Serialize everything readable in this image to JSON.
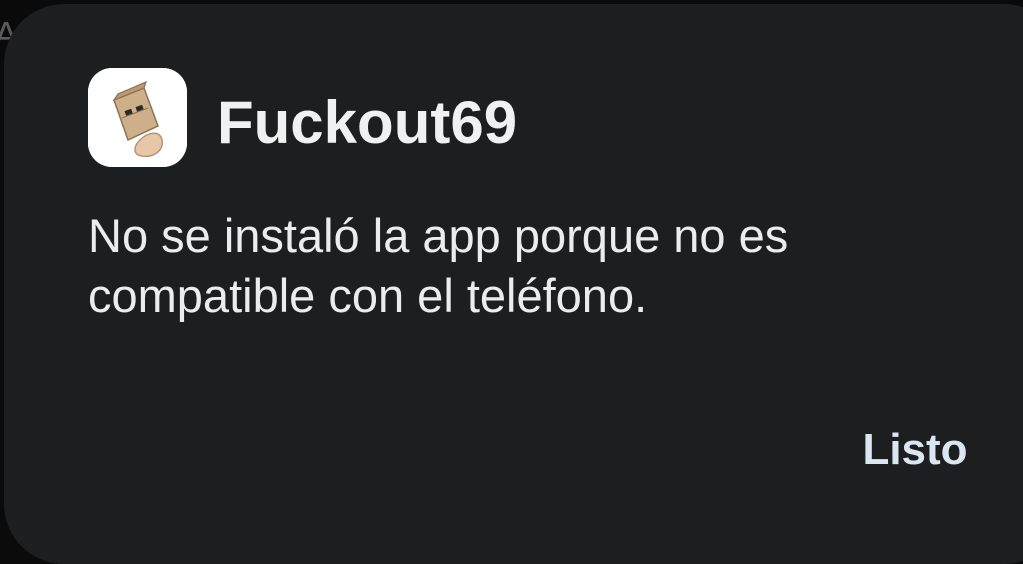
{
  "background": {
    "partial_text": "Ay"
  },
  "dialog": {
    "app_icon": "paper-bag-mask-icon",
    "app_name": "Fuckout69",
    "message": "No se instaló la app porque no es compatible con el teléfono.",
    "done_label": "Listo"
  },
  "colors": {
    "dialog_bg": "#1d1e20",
    "title_text": "#f1f1f1",
    "body_text": "#ececec",
    "button_text": "#dce6f2"
  }
}
